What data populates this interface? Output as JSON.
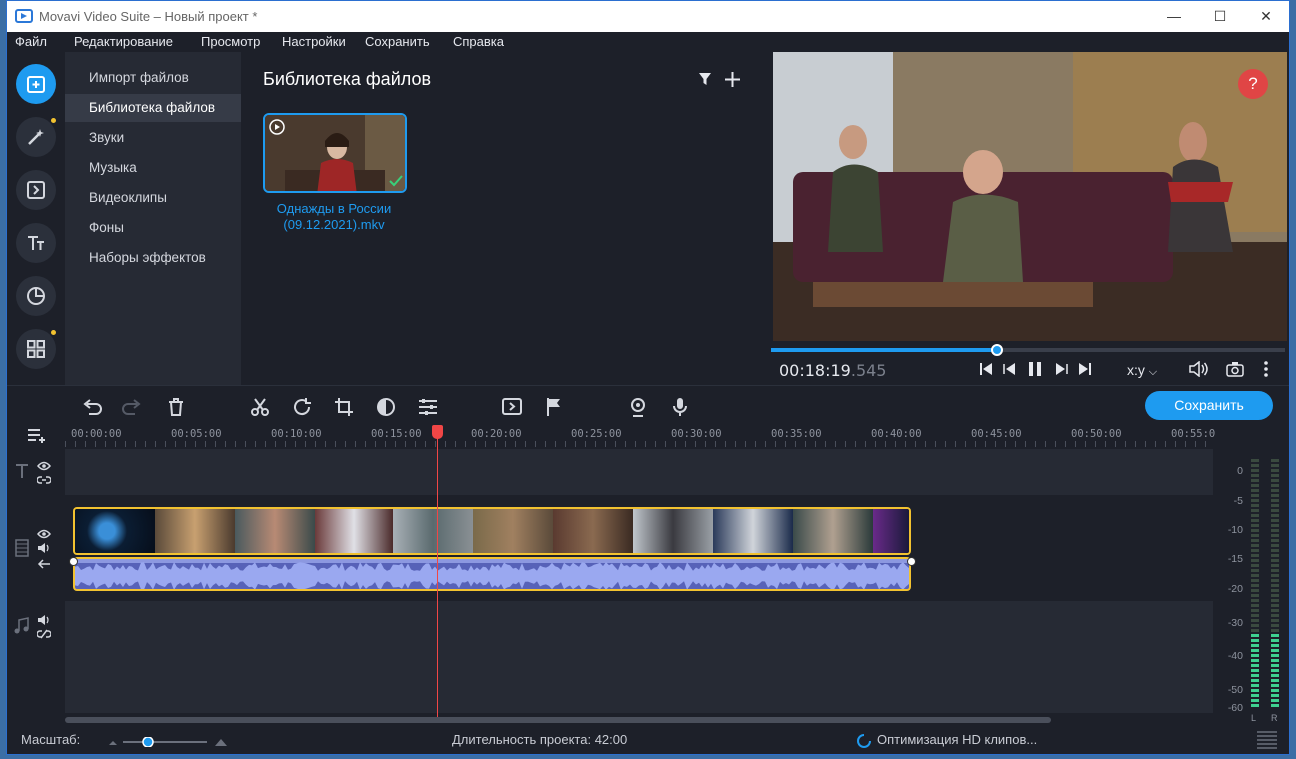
{
  "window": {
    "title": "Movavi Video Suite – Новый проект *",
    "minimize": "—",
    "maximize": "☐",
    "close": "✕"
  },
  "menu": [
    "Файл",
    "Редактирование",
    "Просмотр",
    "Настройки",
    "Сохранить",
    "Справка"
  ],
  "rail": {
    "items": [
      {
        "icon": "import-files-icon",
        "active": true
      },
      {
        "icon": "magic-wand-icon",
        "dot": true
      },
      {
        "icon": "transitions-icon"
      },
      {
        "icon": "titles-icon"
      },
      {
        "icon": "stickers-icon"
      },
      {
        "icon": "more-tools-icon",
        "dot": true
      }
    ]
  },
  "categories": [
    "Импорт файлов",
    "Библиотека файлов",
    "Звуки",
    "Музыка",
    "Видеоклипы",
    "Фоны",
    "Наборы эффектов"
  ],
  "selected_category": "Библиотека файлов",
  "library": {
    "title": "Библиотека файлов",
    "file_caption": "Однажды в России (09.12.2021).mkv"
  },
  "preview": {
    "timecode": "00:18:19",
    "timecode_ms": ".545",
    "aspect": "x:y",
    "progress": 0.44,
    "help": "?"
  },
  "toolbar": {
    "save_label": "Сохранить"
  },
  "ruler": [
    "00:00:00",
    "00:05:00",
    "00:10:00",
    "00:15:00",
    "00:20:00",
    "00:25:00",
    "00:30:00",
    "00:35:00",
    "00:40:00",
    "00:45:00",
    "00:50:00",
    "00:55:0"
  ],
  "meters": {
    "labels": [
      "0",
      "-5",
      "-10",
      "-15",
      "-20",
      "-30",
      "-40",
      "-50",
      "-60"
    ],
    "left": "L",
    "right": "R"
  },
  "status": {
    "zoom_label": "Масштаб:",
    "duration": "Длительность проекта:  42:00",
    "optimization": "Оптимизация HD клипов..."
  },
  "colors": {
    "accent": "#1e9bf0",
    "clip_border": "#f2c230",
    "playhead": "#f04646",
    "audio_wave": "#5762b8"
  }
}
